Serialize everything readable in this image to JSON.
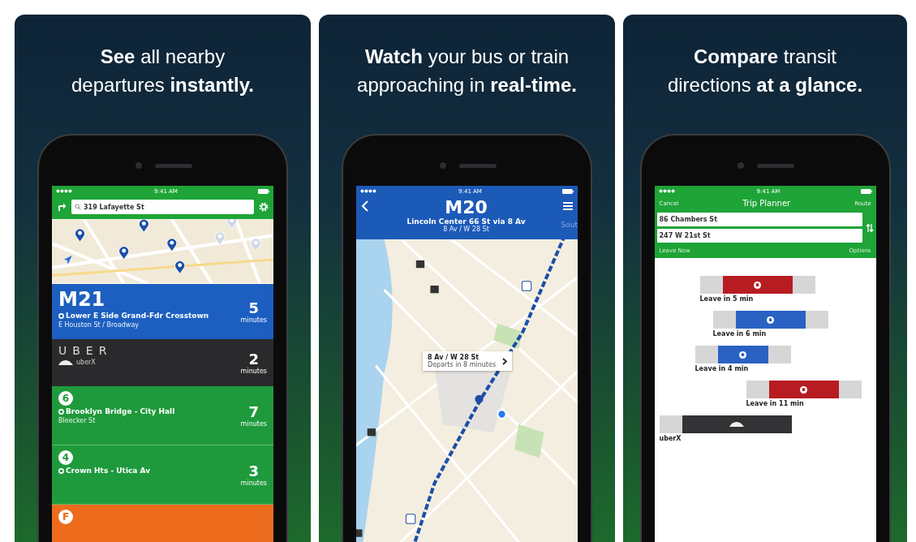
{
  "panels": [
    {
      "kind": "departures",
      "headline": [
        "**See** all nearby",
        "departures **instantly.**"
      ],
      "status": {
        "time": "9:41 AM"
      },
      "search": {
        "value": "319 Lafayette St"
      },
      "departures": [
        {
          "kind": "bus",
          "color": "#1c5fc0",
          "route": "M21",
          "headsign": "Lower E Side Grand-Fdr Crosstown",
          "stop": "E Houston St / Broadway",
          "minutes": "5",
          "unit": "minutes"
        },
        {
          "kind": "ride",
          "color": "#2a2a2c",
          "brand": "UBER",
          "product": "uberX",
          "minutes": "2",
          "unit": "minutes"
        },
        {
          "kind": "train",
          "color": "#1e9a3c",
          "route": "6",
          "headsign": "Brooklyn Bridge - City Hall",
          "stop": "Bleecker St",
          "minutes": "7",
          "unit": "minutes"
        },
        {
          "kind": "train",
          "color": "#1e9a3c",
          "route": "4",
          "headsign": "Crown Hts - Utica Av",
          "minutes": "3",
          "unit": "minutes"
        },
        {
          "kind": "train",
          "color": "#ec6b1c",
          "route": "F"
        }
      ]
    },
    {
      "kind": "route_map",
      "headline": [
        "**Watch** your bus or train",
        "approaching in **real-time.**"
      ],
      "status": {
        "time": "9:41 AM"
      },
      "route": "M20",
      "headsign": "Lincoln Center 66 St via 8 Av",
      "stop": "8 Av / W 28 St",
      "next_direction": "Sout",
      "callout": {
        "title": "8 Av / W 28 St",
        "subtitle": "Departs in 8 minutes"
      }
    },
    {
      "kind": "trip_planner",
      "headline": [
        "**Compare** transit",
        "directions **at a glance.**"
      ],
      "status": {
        "time": "9:41 AM"
      },
      "cancel": "Cancel",
      "title": "Trip Planner",
      "route_button": "Route",
      "from": "86 Chambers St",
      "to": "247 W 21st St",
      "leave": "Leave Now",
      "options": "Options",
      "trips": [
        {
          "kind": "transit",
          "color": "#b71c22",
          "label": "Leave in 5 min"
        },
        {
          "kind": "transit",
          "color": "#2a62c4",
          "label": "Leave in 6 min"
        },
        {
          "kind": "transit",
          "color": "#2a62c4",
          "label": "Leave in 4 min"
        },
        {
          "kind": "transit",
          "color": "#b71c22",
          "label": "Leave in 11 min"
        },
        {
          "kind": "ride",
          "color": "#333336",
          "label": "uberX"
        }
      ]
    }
  ]
}
